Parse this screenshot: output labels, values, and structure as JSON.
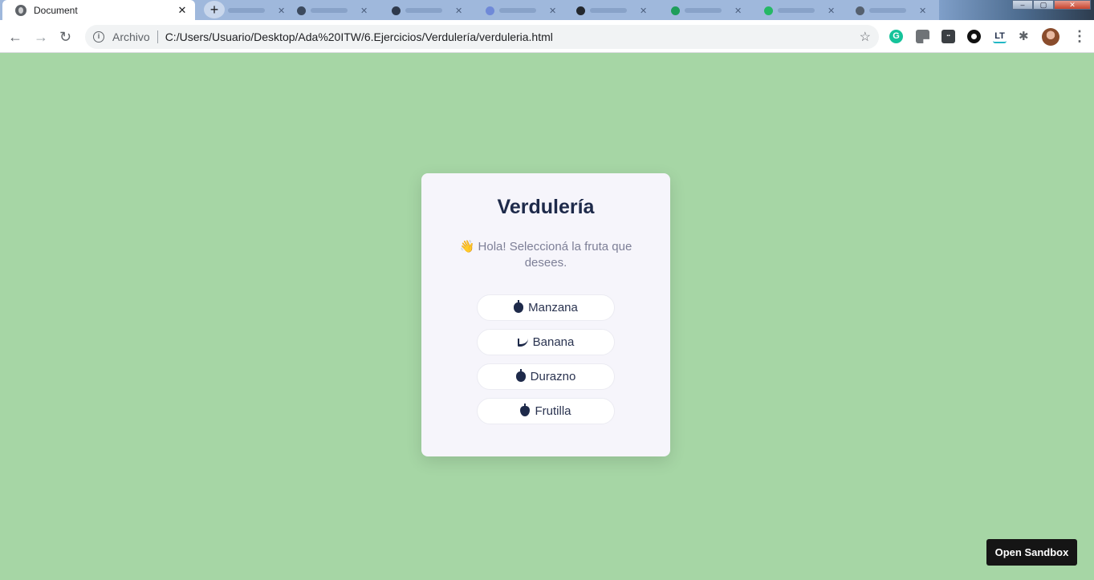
{
  "browser": {
    "active_tab_title": "Document",
    "scheme_label": "Archivo",
    "url": "C:/Users/Usuario/Desktop/Ada%20ITW/6.Ejercicios/Verdulería/verduleria.html"
  },
  "app": {
    "title": "Verdulería",
    "subtitle": "👋 Hola! Seleccioná la fruta que desees.",
    "fruits": [
      {
        "label": "Manzana",
        "icon": "apple-icon"
      },
      {
        "label": "Banana",
        "icon": "banana-icon"
      },
      {
        "label": "Durazno",
        "icon": "peach-icon"
      },
      {
        "label": "Frutilla",
        "icon": "strawberry-icon"
      }
    ],
    "sandbox_label": "Open Sandbox"
  },
  "colors": {
    "page_bg": "#a6d6a5",
    "card_bg": "#f6f5fb",
    "title_color": "#1e2a4a",
    "subtitle_color": "#7d7f97"
  }
}
